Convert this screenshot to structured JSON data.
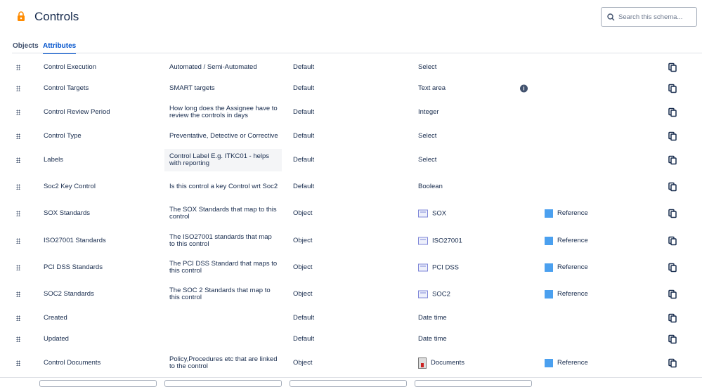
{
  "header": {
    "title": "Controls",
    "search_placeholder": "Search this schema..."
  },
  "tabs": [
    {
      "label": "Objects"
    },
    {
      "label": "Attributes",
      "active": true
    }
  ],
  "colors": {
    "accent": "#0052cc",
    "reference": "#4ba0ef",
    "lock": "#ff8b00"
  },
  "rows": [
    {
      "name": "Control Execution",
      "desc": "Automated / Semi-Automated",
      "cat": "Default",
      "type": "Select"
    },
    {
      "name": "Control Targets",
      "desc": "SMART targets",
      "cat": "Default",
      "type": "Text area",
      "info": true
    },
    {
      "name": "Control Review Period",
      "desc": "How long does the Assignee have to review the controls in days",
      "cat": "Default",
      "type": "Integer"
    },
    {
      "name": "Control Type",
      "desc": "Preventative, Detective or Corrective",
      "cat": "Default",
      "type": "Select"
    },
    {
      "name": "Labels",
      "desc": "Control Label E.g. ITKC01 - helps with reporting",
      "cat": "Default",
      "type": "Select",
      "hl": true
    },
    {
      "name": "Soc2 Key Control",
      "desc": "Is this control a key Control wrt Soc2",
      "cat": "Default",
      "type": "Boolean"
    },
    {
      "name": "SOX Standards",
      "desc": "The SOX Standards that map to this control",
      "cat": "Object",
      "type": "SOX",
      "icon": "object-type-icon",
      "ref": "Reference"
    },
    {
      "name": "ISO27001 Standards",
      "desc": "The ISO27001 standards that map to this control",
      "cat": "Object",
      "type": "ISO27001",
      "icon": "object-type-icon",
      "ref": "Reference"
    },
    {
      "name": "PCI DSS Standards",
      "desc": "The PCI DSS Standard that maps to this control",
      "cat": "Object",
      "type": "PCI DSS",
      "icon": "object-type-icon",
      "ref": "Reference"
    },
    {
      "name": "SOC2 Standards",
      "desc": "The SOC 2 Standards that map to this control",
      "cat": "Object",
      "type": "SOC2",
      "icon": "object-type-icon",
      "ref": "Reference"
    },
    {
      "name": "Created",
      "desc": "",
      "cat": "Default",
      "type": "Date time"
    },
    {
      "name": "Updated",
      "desc": "",
      "cat": "Default",
      "type": "Date time"
    },
    {
      "name": "Control Documents",
      "desc": "Policy,Procedures etc that are linked to the control",
      "cat": "Object",
      "type": "Documents",
      "icon": "document-icon",
      "ref": "Reference"
    }
  ]
}
